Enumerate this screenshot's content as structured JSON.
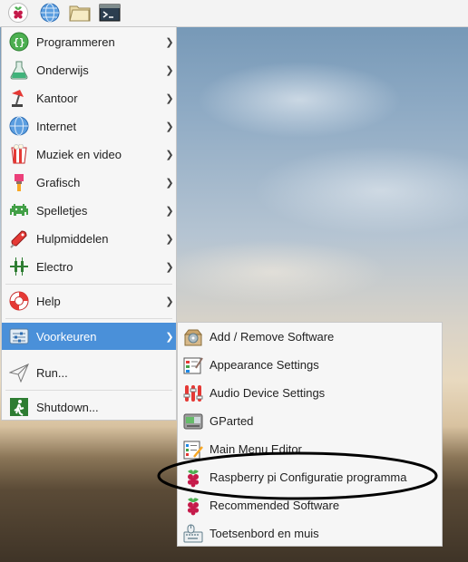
{
  "panel": {
    "icons": [
      "raspberry-menu-icon",
      "web-browser-icon",
      "file-manager-icon",
      "terminal-icon"
    ]
  },
  "main_menu": {
    "items": [
      {
        "label": "Programmeren",
        "icon": "programming-icon"
      },
      {
        "label": "Onderwijs",
        "icon": "education-icon"
      },
      {
        "label": "Kantoor",
        "icon": "office-icon"
      },
      {
        "label": "Internet",
        "icon": "internet-icon"
      },
      {
        "label": "Muziek en video",
        "icon": "music-video-icon"
      },
      {
        "label": "Grafisch",
        "icon": "graphics-icon"
      },
      {
        "label": "Spelletjes",
        "icon": "games-icon"
      },
      {
        "label": "Hulpmiddelen",
        "icon": "accessories-icon"
      },
      {
        "label": "Electro",
        "icon": "electronics-icon"
      },
      {
        "label": "Help",
        "icon": "help-icon"
      },
      {
        "label": "Voorkeuren",
        "icon": "preferences-icon"
      },
      {
        "label": "Run...",
        "icon": "run-icon"
      },
      {
        "label": "Shutdown...",
        "icon": "shutdown-icon"
      }
    ],
    "active": "Voorkeuren"
  },
  "sub_menu": {
    "items": [
      {
        "label": "Add / Remove Software",
        "icon": "add-remove-software-icon"
      },
      {
        "label": "Appearance Settings",
        "icon": "appearance-settings-icon"
      },
      {
        "label": "Audio Device Settings",
        "icon": "audio-device-settings-icon"
      },
      {
        "label": "GParted",
        "icon": "gparted-icon"
      },
      {
        "label": "Main Menu Editor",
        "icon": "main-menu-editor-icon"
      },
      {
        "label": "Raspberry pi Configuratie programma",
        "icon": "raspberry-config-icon"
      },
      {
        "label": "Recommended Software",
        "icon": "recommended-software-icon"
      },
      {
        "label": "Toetsenbord en muis",
        "icon": "keyboard-mouse-icon"
      }
    ],
    "highlighted": "Raspberry pi Configuratie programma"
  },
  "colors": {
    "menu_bg": "#f6f6f6",
    "active_bg": "#4a90d9",
    "annotation": "#000000"
  }
}
